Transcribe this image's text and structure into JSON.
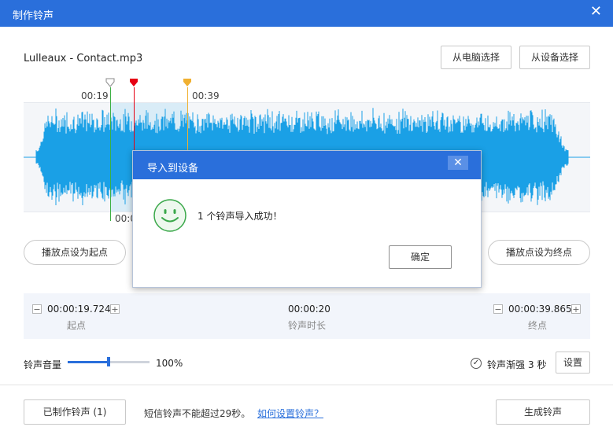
{
  "window": {
    "title": "制作铃声",
    "close_glyph": "✕"
  },
  "file": {
    "name": "Lulleaux - Contact.mp3"
  },
  "source_buttons": {
    "from_pc": "从电脑选择",
    "from_device": "从设备选择"
  },
  "timeline": {
    "start_label": "00:19",
    "end_label": "00:39",
    "cursor_label": "00:0"
  },
  "play_buttons": {
    "set_start": "播放点设为起点",
    "set_end": "播放点设为终点"
  },
  "range": {
    "start_time": "00:00:19.724",
    "start_caption": "起点",
    "duration": "00:00:20",
    "duration_caption": "铃声时长",
    "end_time": "00:00:39.865",
    "end_caption": "终点",
    "minus": "−",
    "plus": "+"
  },
  "volume": {
    "label": "铃声音量",
    "value_text": "100%",
    "level": 0.5
  },
  "fade": {
    "label": "铃声渐强",
    "seconds": "3 秒",
    "settings_button": "设置"
  },
  "footer": {
    "made_button": "已制作铃声 (1)",
    "note": "短信铃声不能超过29秒。",
    "help_link": "如何设置铃声？",
    "generate_button": "生成铃声"
  },
  "dialog": {
    "title": "导入到设备",
    "close_glyph": "✕",
    "message": "1 个铃声导入成功！",
    "ok_button": "确定",
    "icon": "smiley-icon"
  },
  "colors": {
    "accent": "#2a6fdb",
    "wave": "#1aa0e6",
    "wave_selected": "#0f8fc4",
    "start_marker": "#3cb043",
    "cursor_marker": "#e60012",
    "end_marker": "#f0b030"
  }
}
